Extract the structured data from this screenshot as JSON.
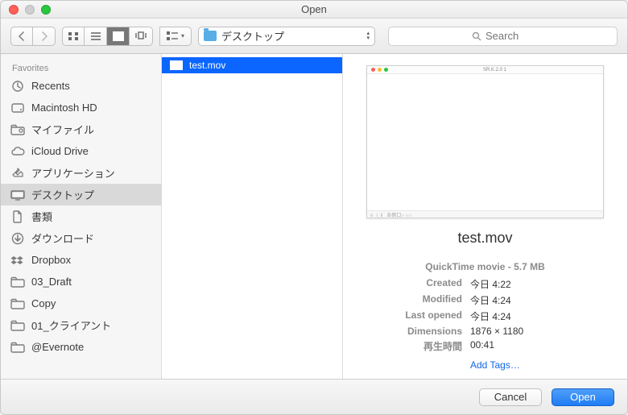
{
  "window": {
    "title": "Open"
  },
  "toolbar": {
    "path_label": "デスクトップ",
    "search_placeholder": "Search"
  },
  "sidebar": {
    "header": "Favorites",
    "items": [
      {
        "icon": "clock",
        "label": "Recents",
        "selected": false
      },
      {
        "icon": "hdd",
        "label": "Macintosh HD",
        "selected": false
      },
      {
        "icon": "smartfolder",
        "label": "マイファイル",
        "selected": false
      },
      {
        "icon": "cloud",
        "label": "iCloud Drive",
        "selected": false
      },
      {
        "icon": "apps",
        "label": "アプリケーション",
        "selected": false
      },
      {
        "icon": "desktop",
        "label": "デスクトップ",
        "selected": true
      },
      {
        "icon": "doc",
        "label": "書類",
        "selected": false
      },
      {
        "icon": "download",
        "label": "ダウンロード",
        "selected": false
      },
      {
        "icon": "dropbox",
        "label": "Dropbox",
        "selected": false
      },
      {
        "icon": "folder",
        "label": "03_Draft",
        "selected": false
      },
      {
        "icon": "folder",
        "label": "Copy",
        "selected": false
      },
      {
        "icon": "folder",
        "label": "01_クライアント",
        "selected": false
      },
      {
        "icon": "folder",
        "label": "@Evernote",
        "selected": false
      }
    ]
  },
  "files": [
    {
      "name": "test.mov",
      "selected": true
    }
  ],
  "preview": {
    "filename": "test.mov",
    "type_line": "QuickTime movie - 5.7 MB",
    "rows": [
      {
        "k": "Created",
        "v": "今日 4:22"
      },
      {
        "k": "Modified",
        "v": "今日 4:24"
      },
      {
        "k": "Last opened",
        "v": "今日 4:24"
      },
      {
        "k": "Dimensions",
        "v": "1876 × 1180"
      },
      {
        "k": "再生時間",
        "v": "00:41"
      }
    ],
    "add_tags": "Add Tags…"
  },
  "footer": {
    "cancel": "Cancel",
    "open": "Open"
  }
}
